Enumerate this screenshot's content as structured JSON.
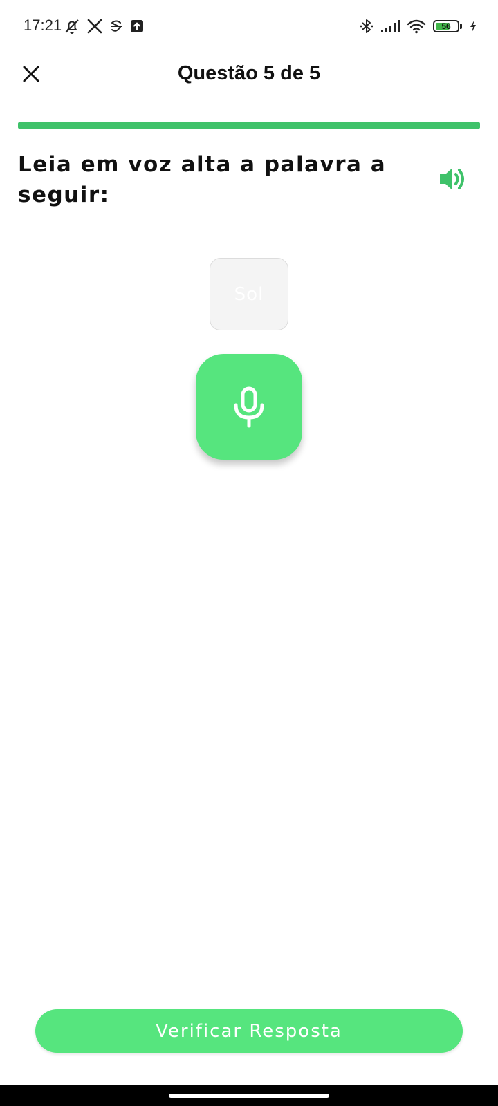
{
  "status_bar": {
    "time": "17:21",
    "battery_level": "56"
  },
  "header": {
    "title": "Questão 5 de 5"
  },
  "progress": {
    "current": 5,
    "total": 5,
    "fraction": 1.0
  },
  "prompt": {
    "text": "Leia em voz alta a palavra a seguir:"
  },
  "word_card": {
    "word": "Sol"
  },
  "actions": {
    "verify_label": "Verificar Resposta"
  },
  "icons": {
    "close": "close-icon",
    "speaker": "speaker-icon",
    "microphone": "microphone-icon"
  },
  "colors": {
    "accent": "#56e57e",
    "progress": "#3fc26a",
    "speaker": "#3fc26a"
  }
}
